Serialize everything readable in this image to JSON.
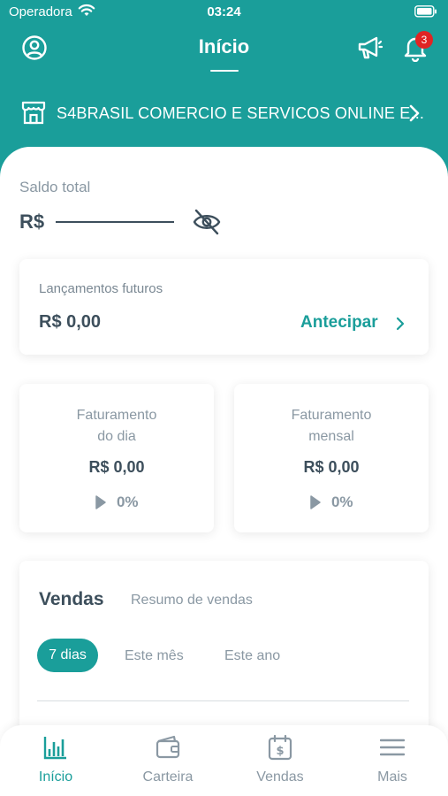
{
  "status_bar": {
    "carrier": "Operadora",
    "time": "03:24"
  },
  "header": {
    "title": "Início",
    "notification_count": "3"
  },
  "store": {
    "name": "S4BRASIL COMERCIO E SERVICOS ONLINE E..."
  },
  "saldo": {
    "label": "Saldo total",
    "currency": "R$"
  },
  "lancamentos": {
    "label": "Lançamentos futuros",
    "value": "R$ 0,00",
    "action_label": "Antecipar"
  },
  "faturamento": [
    {
      "label_line1": "Faturamento",
      "label_line2": "do dia",
      "value": "R$ 0,00",
      "percent": "0%"
    },
    {
      "label_line1": "Faturamento",
      "label_line2": "mensal",
      "value": "R$ 0,00",
      "percent": "0%"
    }
  ],
  "vendas": {
    "title": "Vendas",
    "subtitle": "Resumo de vendas",
    "periods": [
      "7 dias",
      "Este mês",
      "Este ano"
    ],
    "selected_period": "7 dias"
  },
  "tabbar": {
    "items": [
      {
        "label": "Início",
        "icon": "bar-chart-icon",
        "active": true
      },
      {
        "label": "Carteira",
        "icon": "wallet-icon",
        "active": false
      },
      {
        "label": "Vendas",
        "icon": "calendar-dollar-icon",
        "active": false
      },
      {
        "label": "Mais",
        "icon": "menu-icon",
        "active": false
      }
    ]
  },
  "colors": {
    "primary": "#1a9e9a",
    "text_dark": "#3d4f5c",
    "text_muted": "#8a98a3",
    "badge": "#e02424"
  }
}
